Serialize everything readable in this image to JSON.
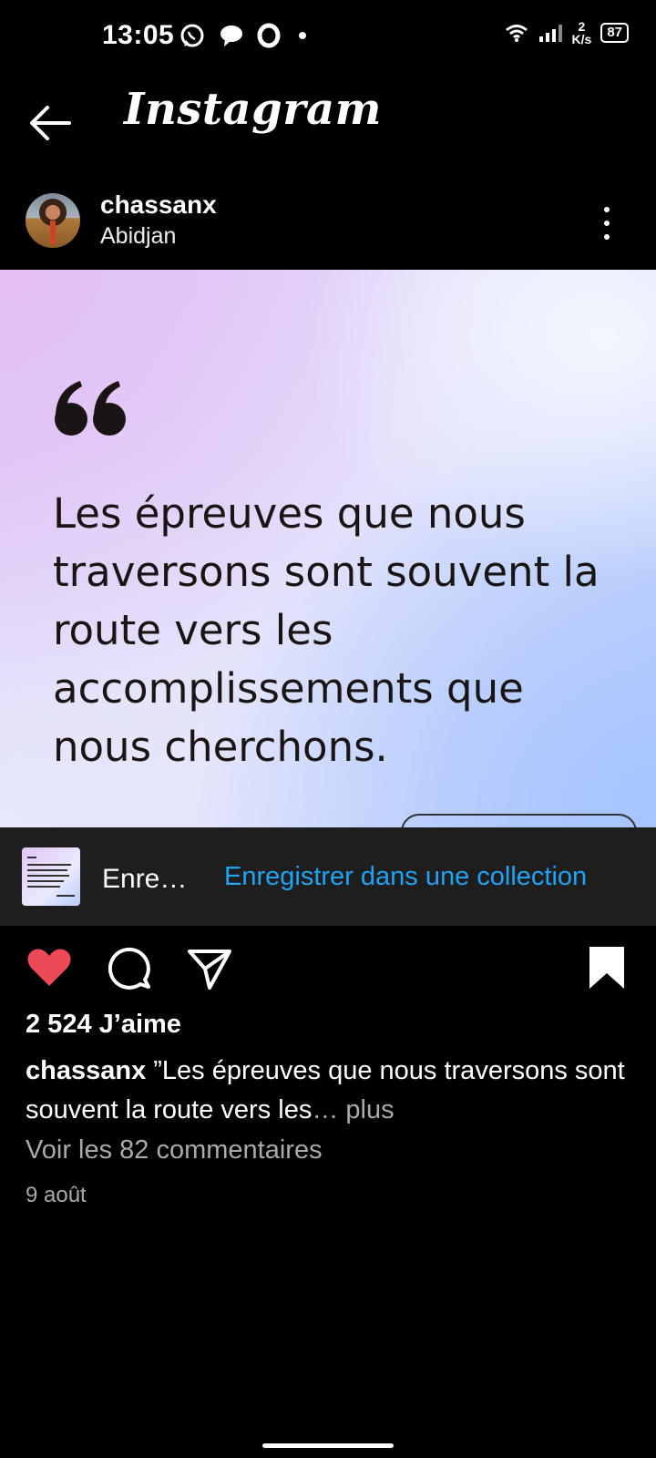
{
  "status_bar": {
    "time": "13:05",
    "network_speed_value": "2",
    "network_speed_unit": "K/s",
    "battery": "87",
    "icons": [
      "whatsapp-icon",
      "chat-bubble-icon",
      "opera-icon",
      "dot-icon",
      "wifi-icon",
      "signal-icon",
      "battery-icon"
    ]
  },
  "top_bar": {
    "title": "Instagram",
    "back_icon": "arrow-left-icon"
  },
  "post_header": {
    "username": "chassanx",
    "location": "Abidjan",
    "menu_icon": "more-vertical-icon"
  },
  "post_image": {
    "quote_mark": "“",
    "quote_text": "Les épreuves que nous traversons sont souvent la route vers les accomplissements que nous cherchons.",
    "colors": {
      "top_left": "#e3c0f6",
      "bottom_right": "#a6c4ff",
      "text": "#1a1414"
    }
  },
  "collection_banner": {
    "short_label": "Enre…",
    "link_label": "Enregistrer dans une collection",
    "link_color": "#1ea3f5"
  },
  "actions": {
    "like_icon": "heart-filled-icon",
    "comment_icon": "comment-icon",
    "share_icon": "send-icon",
    "save_icon": "bookmark-filled-icon",
    "like_color": "#ed4956"
  },
  "post_info": {
    "likes": "2 524 J’aime",
    "caption_user": "chassanx",
    "caption_text": " ”Les épreuves que nous traversons sont souvent la route vers les",
    "caption_more": "… plus",
    "comments_link": "Voir les 82 commentaires",
    "date": "9 août"
  }
}
